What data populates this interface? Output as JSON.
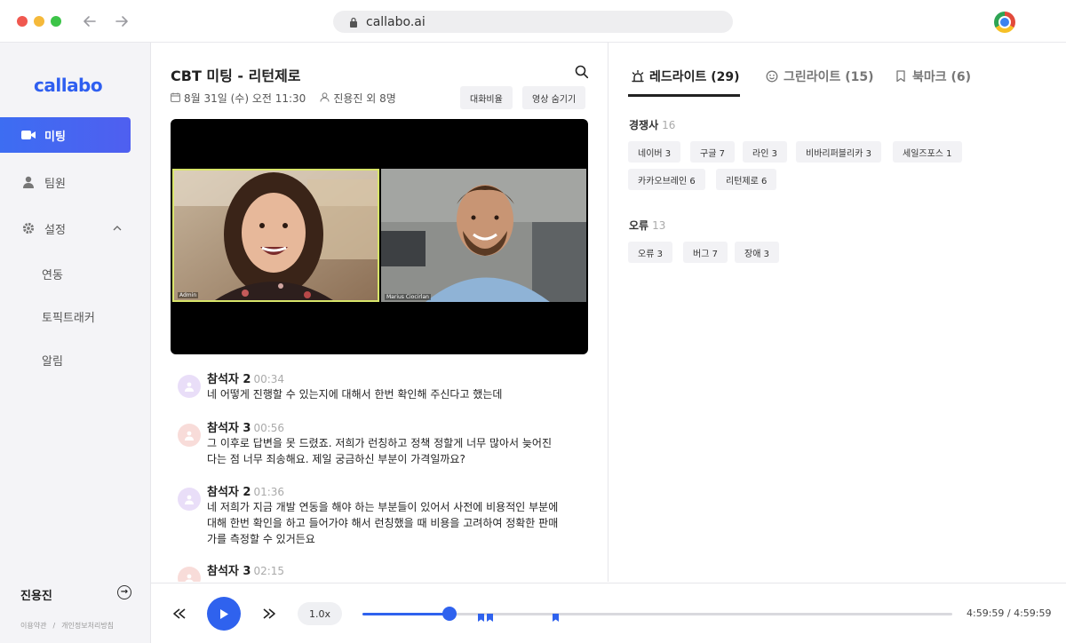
{
  "browser": {
    "url": "callabo.ai"
  },
  "sidebar": {
    "logo": "callabo",
    "items": [
      {
        "label": "미팅"
      },
      {
        "label": "팀원"
      },
      {
        "label": "설정"
      }
    ],
    "sub_items": [
      {
        "label": "연동"
      },
      {
        "label": "토픽트래커"
      },
      {
        "label": "알림"
      }
    ],
    "user_name": "진용진",
    "footer_terms": "이용약관",
    "footer_sep": "/",
    "footer_privacy": "개인정보처리방침"
  },
  "meeting": {
    "title": "CBT 미팅 - 리턴제로",
    "date": "8월 31일 (수) 오전 11:30",
    "participants": "진용진 외 8명",
    "btn_ratio": "대화비율",
    "btn_hide_video": "영상 숨기기",
    "video_tiles": [
      {
        "caption": "Admin"
      },
      {
        "caption": "Marius Ciocirlan"
      }
    ]
  },
  "transcript": [
    {
      "speaker": "참석자 2",
      "time": "00:34",
      "text": "네 어떻게 진행할 수 있는지에 대해서 한번 확인해 주신다고 했는데"
    },
    {
      "speaker": "참석자 3",
      "time": "00:56",
      "text": "그 이후로 답변을 못 드렸죠. 저희가 런칭하고 정책 정할게 너무 많아서 늦어진 다는 점 너무 죄송해요. 제일 궁금하신 부분이 가격일까요?"
    },
    {
      "speaker": "참석자 2",
      "time": "01:36",
      "text": "네 저희가 지금 개발 연동을 해야 하는 부분들이 있어서 사전에 비용적인 부분에 대해 한번 확인을 하고 들어가야 해서 런칭했을 때 비용을 고려하여 정확한 판매 가를 측정할 수 있거든요"
    },
    {
      "speaker": "참석자 3",
      "time": "02:15",
      "text": ""
    }
  ],
  "tabs": [
    {
      "label": "레드라이트 (29)"
    },
    {
      "label": "그린라이트 (15)"
    },
    {
      "label": "북마크 (6)"
    }
  ],
  "sections": [
    {
      "title": "경쟁사",
      "count": "16",
      "keywords": [
        "네이버 3",
        "구글 7",
        "라인 3",
        "비바리퍼블리카 3",
        "세일즈포스 1",
        "카카오브레인 6",
        "리턴제로 6"
      ]
    },
    {
      "title": "오류",
      "count": "13",
      "keywords": [
        "오류 3",
        "버그 7",
        "장애 3"
      ]
    }
  ],
  "player": {
    "speed": "1.0x",
    "time": "4:59:59 / 4:59:59",
    "progress": 0.148,
    "bookmarks": [
      0.2,
      0.216,
      0.327
    ]
  },
  "colors": {
    "accent": "#2f62ee",
    "active_nav_start": "#3d6df2",
    "active_nav_end": "#4f5ff0",
    "chip_bg": "#f2f2f5"
  }
}
